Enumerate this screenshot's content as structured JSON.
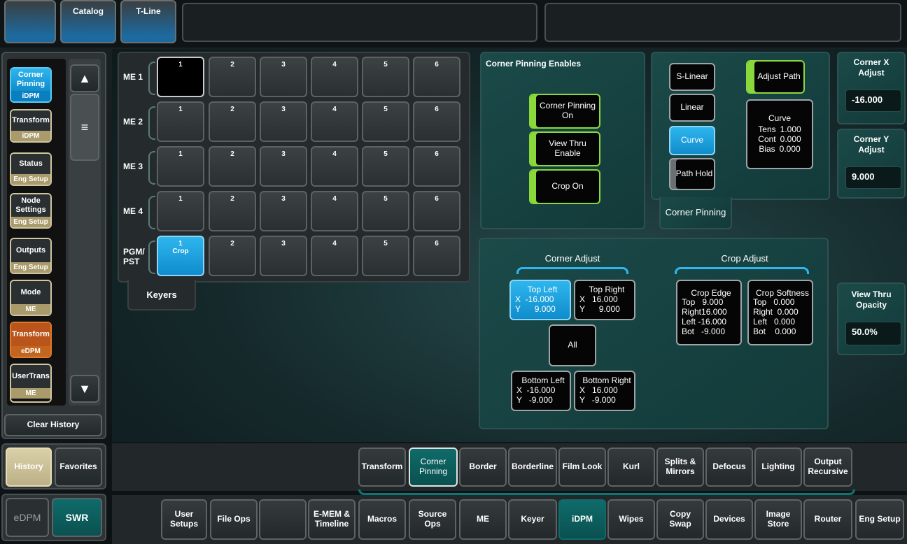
{
  "topbar": {
    "tab1": "",
    "tab2": "Catalog",
    "tab3": "T-Line"
  },
  "sidebar": {
    "items": [
      {
        "label": "Corner Pinning",
        "sub": "iDPM"
      },
      {
        "label": "Transform",
        "sub": "iDPM"
      },
      {
        "label": "Status",
        "sub": "Eng Setup"
      },
      {
        "label": "Node Settings",
        "sub": "Eng Setup"
      },
      {
        "label": "Outputs",
        "sub": "Eng Setup"
      },
      {
        "label": "Mode",
        "sub": "ME"
      },
      {
        "label": "Transform",
        "sub": "eDPM"
      },
      {
        "label": "UserTrans",
        "sub": "ME"
      }
    ],
    "clear_history": "Clear History",
    "history": "History",
    "favorites": "Favorites",
    "edpm": "eDPM",
    "swr": "SWR"
  },
  "keyers": {
    "tab_label": "Keyers",
    "rows": [
      {
        "label": "ME 1",
        "cells": [
          "1",
          "2",
          "3",
          "4",
          "5",
          "6"
        ]
      },
      {
        "label": "ME 2",
        "cells": [
          "1",
          "2",
          "3",
          "4",
          "5",
          "6"
        ]
      },
      {
        "label": "ME 3",
        "cells": [
          "1",
          "2",
          "3",
          "4",
          "5",
          "6"
        ]
      },
      {
        "label": "ME 4",
        "cells": [
          "1",
          "2",
          "3",
          "4",
          "5",
          "6"
        ]
      },
      {
        "label": "PGM/ PST",
        "cells": [
          "1",
          "2",
          "3",
          "4",
          "5",
          "6"
        ]
      }
    ],
    "pgm_cell1_sub": "Crop"
  },
  "enables": {
    "title": "Corner Pinning Enables",
    "corner_on": "Corner Pinning On",
    "view_thru": "View Thru Enable",
    "crop_on": "Crop On"
  },
  "path": {
    "slinear": "S-Linear",
    "linear": "Linear",
    "curve": "Curve",
    "path_hold": "Path Hold",
    "adjust_path": "Adjust Path",
    "curve_title": "Curve",
    "tens_label": "Tens",
    "tens": "1.000",
    "cont_label": "Cont",
    "cont": "0.000",
    "bias_label": "Bias",
    "bias": "0.000",
    "tab_label": "Corner Pinning"
  },
  "corner_x": {
    "title": "Corner X Adjust",
    "value": "-16.000"
  },
  "corner_y": {
    "title": "Corner Y Adjust",
    "value": "9.000"
  },
  "view_thru_opacity": {
    "title": "View Thru Opacity",
    "value": "50.0%"
  },
  "corner_adjust": {
    "title": "Corner Adjust",
    "top_left": {
      "title": "Top Left",
      "x": "X  -16.000",
      "y": "Y      9.000"
    },
    "top_right": {
      "title": "Top Right",
      "x": "X   16.000",
      "y": "Y      9.000"
    },
    "all": "All",
    "bottom_left": {
      "title": "Bottom Left",
      "x": "X  -16.000",
      "y": "Y   -9.000"
    },
    "bottom_right": {
      "title": "Bottom Right",
      "x": "X   16.000",
      "y": "Y   -9.000"
    }
  },
  "crop_adjust": {
    "title": "Crop Adjust",
    "edge": {
      "title": "Crop Edge",
      "top": "Top   9.000",
      "right": "Right16.000",
      "left": "Left -16.000",
      "bot": "Bot   -9.000"
    },
    "softness": {
      "title": "Crop Softness",
      "top": "Top   0.000",
      "right": "Right  0.000",
      "left": "Left   0.000",
      "bot": "Bot    0.000"
    }
  },
  "subtabs": [
    "Transform",
    "Corner Pinning",
    "Border",
    "Borderline",
    "Film Look",
    "Kurl",
    "Splits & Mirrors",
    "Defocus",
    "Lighting",
    "Output Recursive"
  ],
  "bottom": [
    "User Setups",
    "File Ops",
    "",
    "E-MEM & Timeline",
    "Macros",
    "Source Ops",
    "ME",
    "Keyer",
    "iDPM",
    "Wipes",
    "Copy Swap",
    "Devices",
    "Image Store",
    "Router",
    "Eng Setup"
  ]
}
